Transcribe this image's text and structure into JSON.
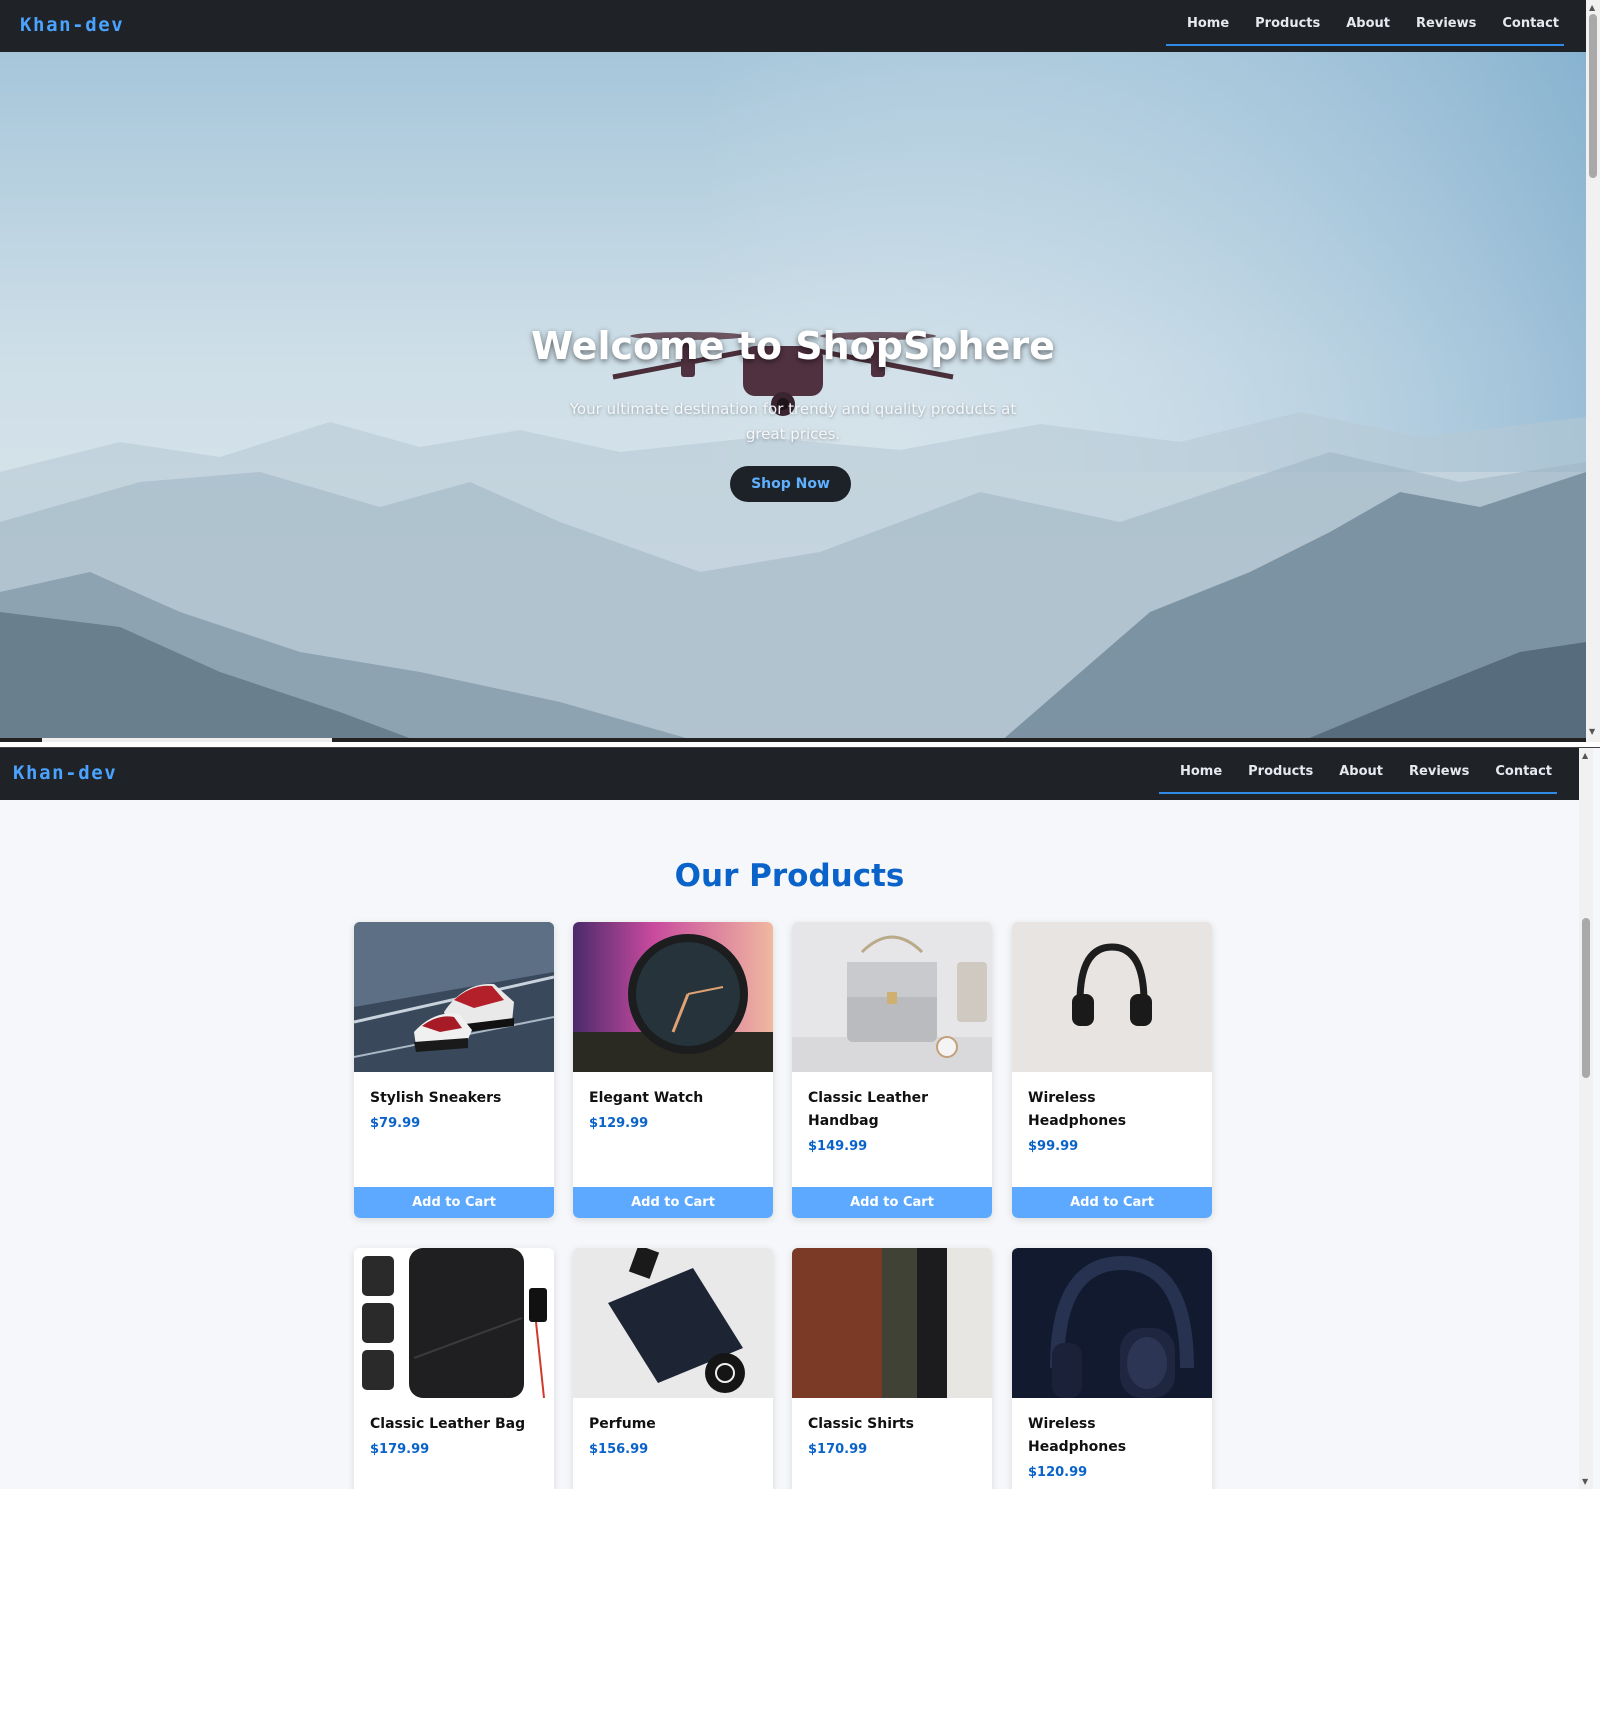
{
  "navbar": {
    "brand": "Khan-dev",
    "links": [
      "Home",
      "Products",
      "About",
      "Reviews",
      "Contact"
    ]
  },
  "hero": {
    "title": "Welcome to ShopSphere",
    "subtitle": "Your ultimate destination for trendy and quality products at great prices.",
    "button": "Shop Now"
  },
  "products": {
    "title": "Our Products",
    "cart_label": "Add to Cart",
    "items": [
      {
        "name": "Stylish Sneakers",
        "price": "$79.99",
        "icon": "sneakers-image"
      },
      {
        "name": "Elegant Watch",
        "price": "$129.99",
        "icon": "watch-image"
      },
      {
        "name": "Classic Leather Handbag",
        "price": "$149.99",
        "icon": "handbag-image"
      },
      {
        "name": "Wireless Headphones",
        "price": "$99.99",
        "icon": "headphones-image"
      },
      {
        "name": "Classic Leather Bag",
        "price": "$179.99",
        "icon": "backpack-image"
      },
      {
        "name": "Perfume",
        "price": "$156.99",
        "icon": "perfume-image"
      },
      {
        "name": "Classic Shirts",
        "price": "$170.99",
        "icon": "shirts-image"
      },
      {
        "name": "Wireless Headphones",
        "price": "$120.99",
        "icon": "headphones-image"
      }
    ]
  },
  "colors": {
    "navbar": "#1f2328",
    "brand": "#4aa3ff",
    "accent": "#0a63c9",
    "cart_button": "#5ca9ff"
  }
}
